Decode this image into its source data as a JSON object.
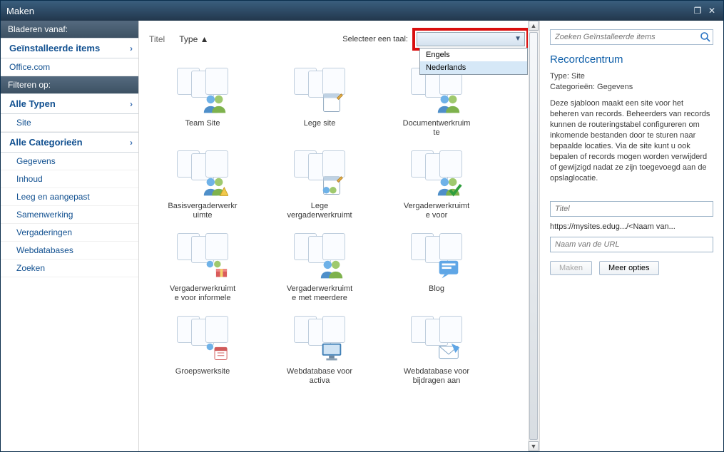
{
  "window": {
    "title": "Maken"
  },
  "left": {
    "browse_header": "Bladeren vanaf:",
    "installed": "Geïnstalleerde items",
    "office": "Office.com",
    "filter_header": "Filteren op:",
    "all_types": "Alle Typen",
    "type_items": [
      "Site"
    ],
    "all_categories": "Alle Categorieën",
    "category_items": [
      "Gegevens",
      "Inhoud",
      "Leeg en aangepast",
      "Samenwerking",
      "Vergaderingen",
      "Webdatabases",
      "Zoeken"
    ]
  },
  "center": {
    "sort_title": "Titel",
    "sort_type": "Type",
    "lang_label": "Selecteer een taal:",
    "lang_options": [
      "Engels",
      "Nederlands"
    ],
    "tiles": [
      {
        "label": "Team Site",
        "ov": "people"
      },
      {
        "label": "Lege site",
        "ov": "note"
      },
      {
        "label": "Documentwerkruim\nte",
        "ov": "people"
      },
      {
        "label": "Basisvergaderwerkr\nuimte",
        "ov": "people-warn"
      },
      {
        "label": "Lege\nvergaderwerkruimt",
        "ov": "note-people"
      },
      {
        "label": "Vergaderwerkruimt\ne voor",
        "ov": "people-check"
      },
      {
        "label": "Vergaderwerkruimt\ne voor informele",
        "ov": "gift"
      },
      {
        "label": "Vergaderwerkruimt\ne met meerdere",
        "ov": "people"
      },
      {
        "label": "Blog",
        "ov": "blog"
      },
      {
        "label": "Groepswerksite",
        "ov": "cal"
      },
      {
        "label": "Webdatabase voor\nactiva",
        "ov": "screen"
      },
      {
        "label": "Webdatabase voor\nbijdragen aan",
        "ov": "envelope"
      }
    ]
  },
  "right": {
    "search_placeholder": "Zoeken Geïnstalleerde items",
    "title": "Recordcentrum",
    "meta_type": "Type: Site",
    "meta_cat": "Categorieën: Gegevens",
    "desc": "Deze sjabloon maakt een site voor het beheren van records. Beheerders van records kunnen de routeringstabel configureren om inkomende bestanden door te sturen naar bepaalde locaties. Via de site kunt u ook bepalen of records mogen worden verwijderd of gewijzigd nadat ze zijn toegevoegd aan de opslaglocatie.",
    "title_ph": "Titel",
    "url_prefix": "https://mysites.edug.../<Naam van...",
    "url_ph": "Naam van de URL",
    "btn_make": "Maken",
    "btn_more": "Meer opties"
  }
}
